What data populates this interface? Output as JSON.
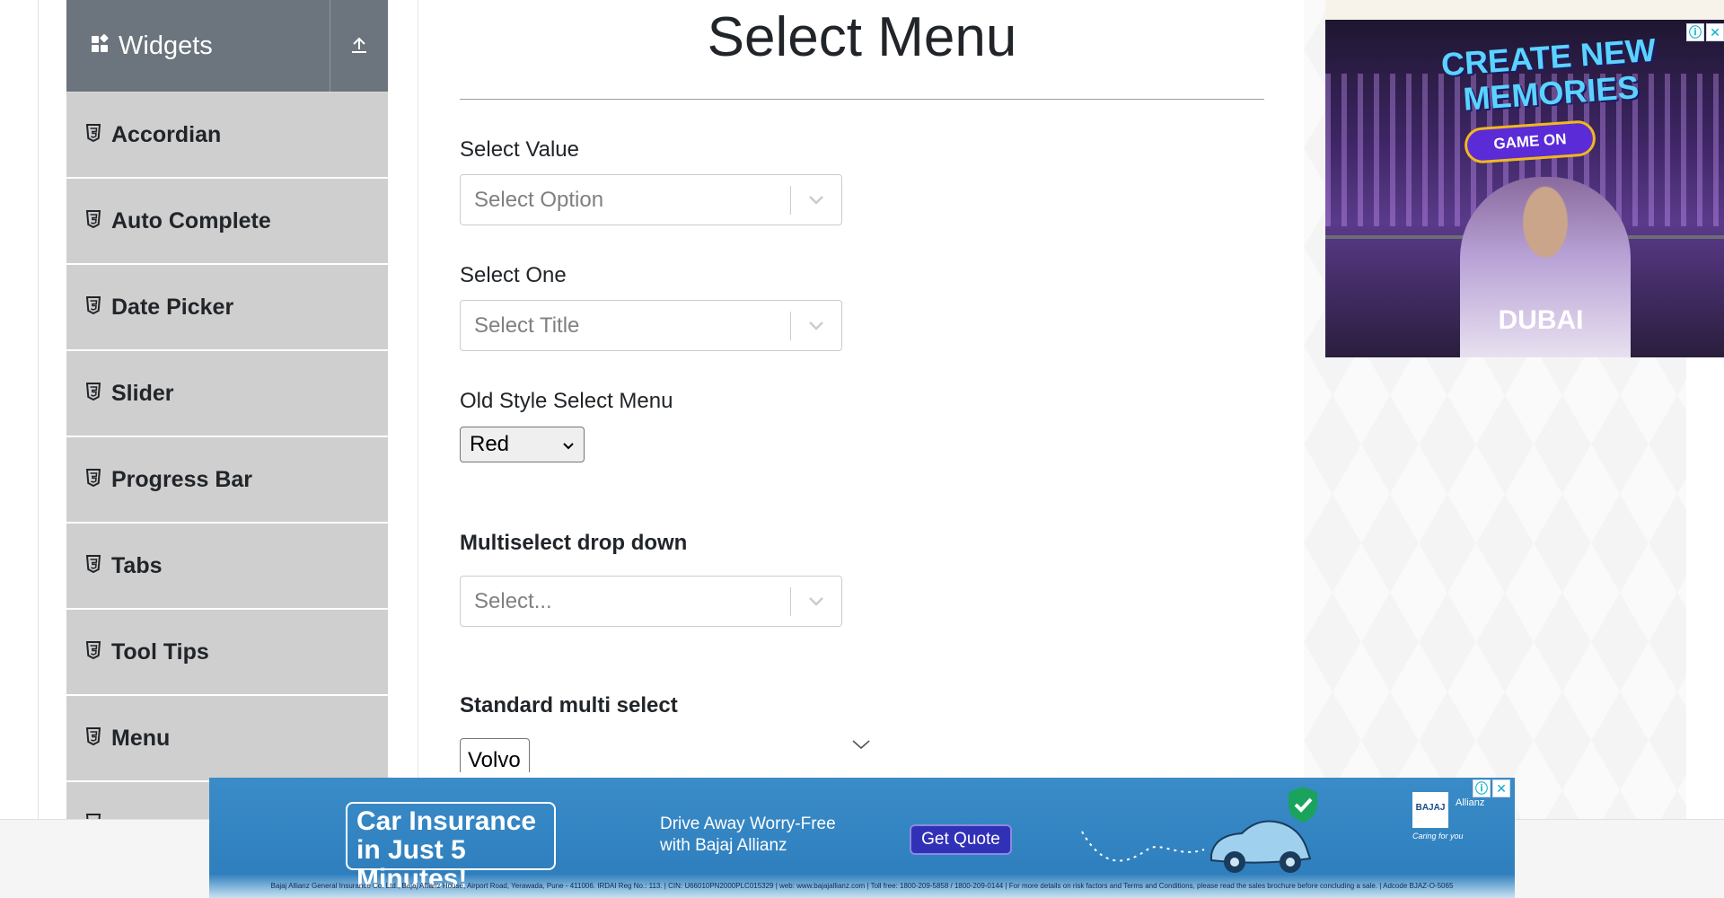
{
  "sidebar": {
    "group_title": "Widgets",
    "items": [
      {
        "label": "Accordian"
      },
      {
        "label": "Auto Complete"
      },
      {
        "label": "Date Picker"
      },
      {
        "label": "Slider"
      },
      {
        "label": "Progress Bar"
      },
      {
        "label": "Tabs"
      },
      {
        "label": "Tool Tips"
      },
      {
        "label": "Menu"
      }
    ]
  },
  "main": {
    "title": "Select Menu",
    "select_value": {
      "label": "Select Value",
      "placeholder": "Select Option"
    },
    "select_one": {
      "label": "Select One",
      "placeholder": "Select Title"
    },
    "old_style": {
      "label": "Old Style Select Menu",
      "selected": "Red"
    },
    "multiselect": {
      "label": "Multiselect drop down",
      "placeholder": "Select..."
    },
    "standard_multi": {
      "label": "Standard multi select",
      "first_option": "Volvo"
    }
  },
  "ads": {
    "right": {
      "headline": "CREATE NEW MEMORIES",
      "badge": "GAME ON",
      "brand": "DUBAI",
      "info_icon": "ⓘ",
      "close_icon": "✕"
    },
    "bottom": {
      "headline_line1": "Car Insurance",
      "headline_line2": "in Just 5 Minutes!",
      "sub_line1": "Drive Away Worry-Free",
      "sub_line2": "with Bajaj Allianz",
      "cta": "Get Quote",
      "logo_text": "BAJAJ",
      "partner_text": "Allianz",
      "tagline": "Caring for you",
      "legal": "Bajaj Allianz General Insurance Co. Ltd., Bajaj Allianz House, Airport Road, Yerawada, Pune - 411006. IRDAI Reg No.: 113. | CIN: U66010PN2000PLC015329 | web: www.bajajallianz.com | Toll free: 1800-209-5858 / 1800-209-0144 | For more details on risk factors and Terms and Conditions, please read the sales brochure before concluding a sale. | Adcode BJAZ-O-5065",
      "info_icon": "ⓘ",
      "close_icon": "✕"
    }
  },
  "colors": {
    "sidebar_header": "#6c757d",
    "sidebar_item": "#cfcfcf",
    "ad_blue": "#2f7fbe",
    "cta_blue": "#3131b8"
  }
}
